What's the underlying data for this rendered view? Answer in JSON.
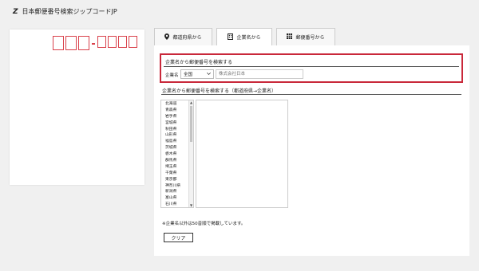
{
  "header": {
    "logo_mark": "Z",
    "title": "日本郵便番号検索ジップコードJP"
  },
  "tabs": [
    {
      "label": "都道府県から",
      "icon": "map-pin-icon"
    },
    {
      "label": "企業名から",
      "icon": "building-icon"
    },
    {
      "label": "郵便番号から",
      "icon": "grid-icon"
    }
  ],
  "company_search": {
    "title": "企業名から郵便番号を検索する",
    "field_label": "企業名",
    "prefecture_value": "全国",
    "company_placeholder": "株式会社日本"
  },
  "browse": {
    "title": "企業名から郵便番号を検索する（都道府県→企業名）",
    "prefectures": [
      "北海道",
      "青森県",
      "岩手県",
      "宮城県",
      "秋田県",
      "山形県",
      "福島県",
      "茨城県",
      "栃木県",
      "群馬県",
      "埼玉県",
      "千葉県",
      "東京都",
      "神奈川県",
      "新潟県",
      "富山県",
      "石川県"
    ]
  },
  "note": "※企業名以外は50音順で掲載しています。",
  "clear_label": "クリア",
  "colors": {
    "accent_red": "#c9283a",
    "postcard_red": "#d9414b"
  }
}
